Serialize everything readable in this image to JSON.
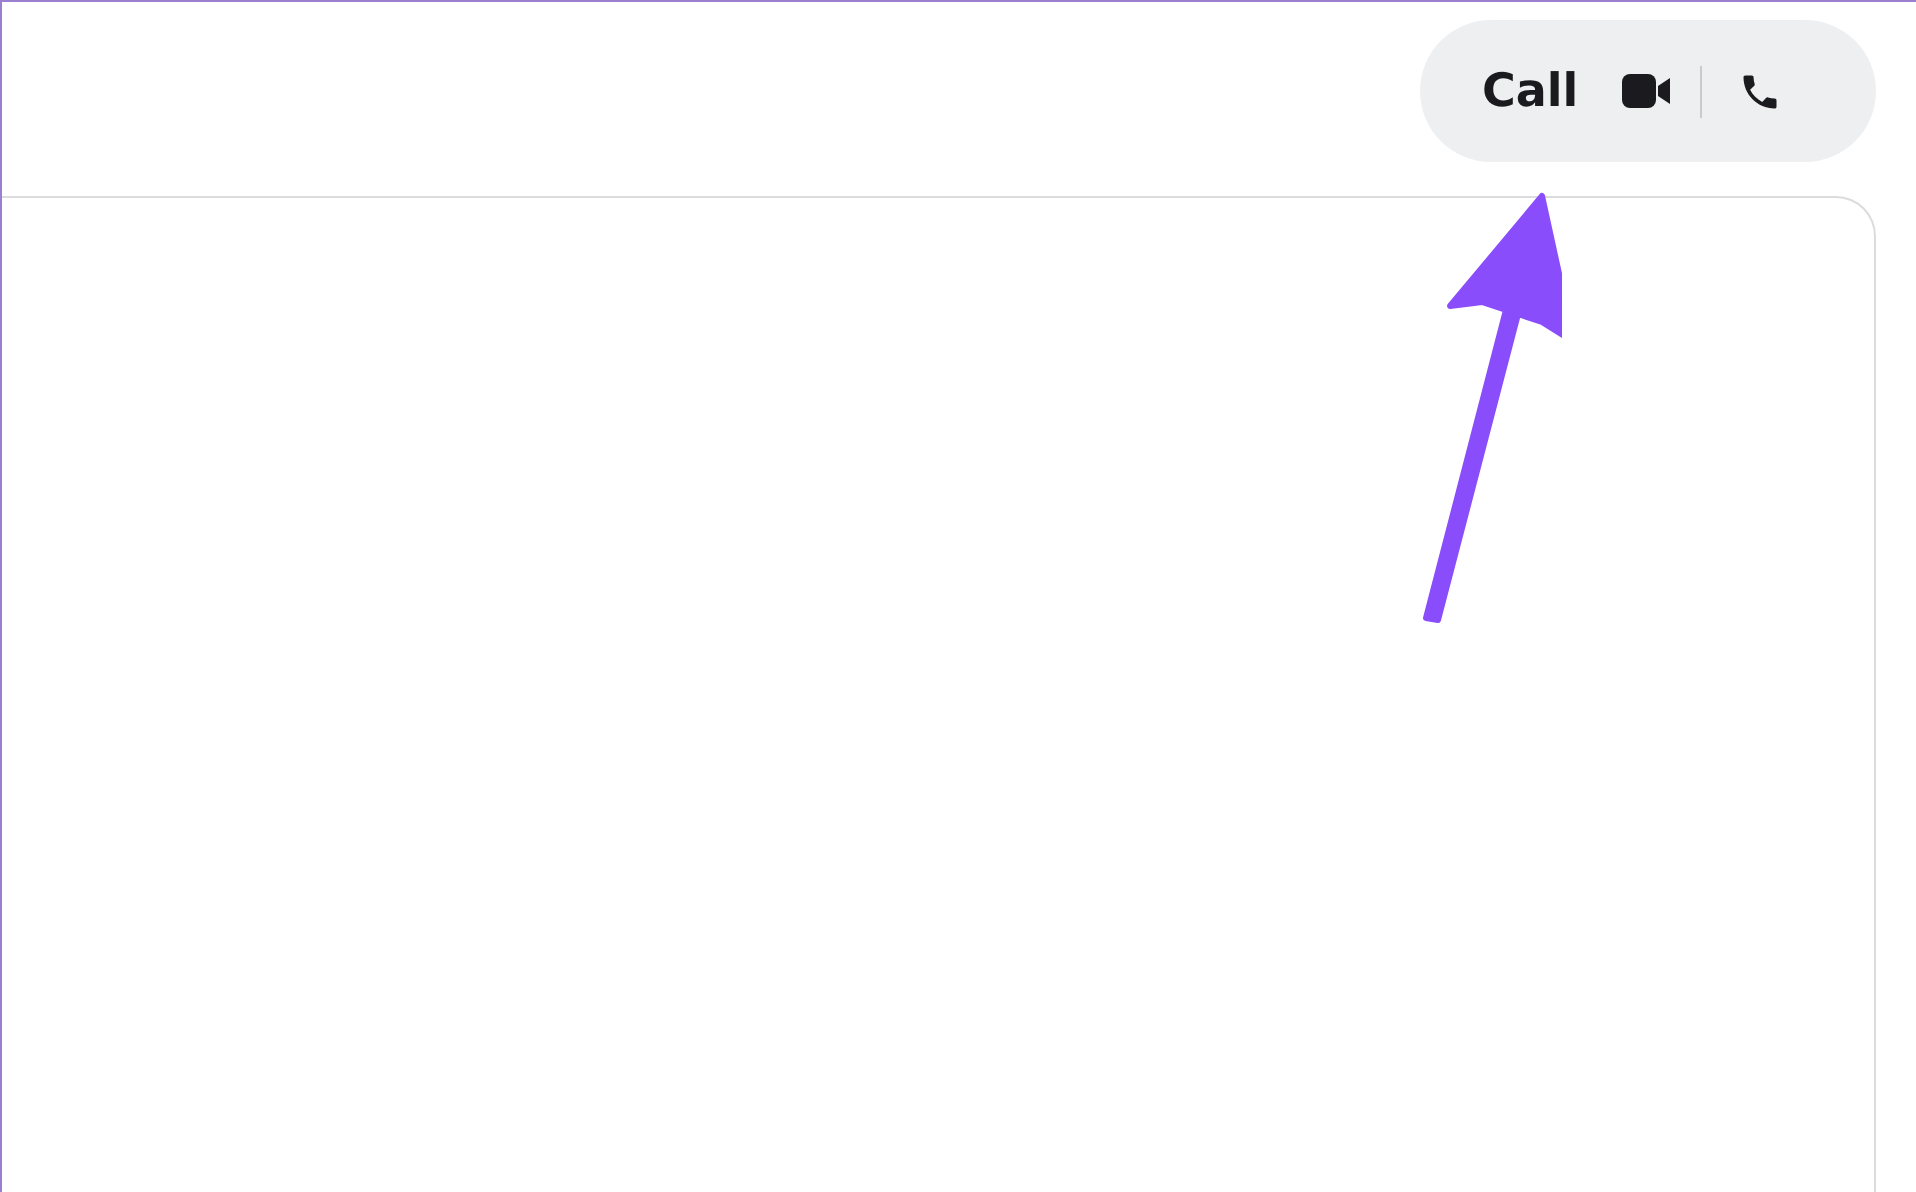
{
  "call_button": {
    "label": "Call"
  }
}
